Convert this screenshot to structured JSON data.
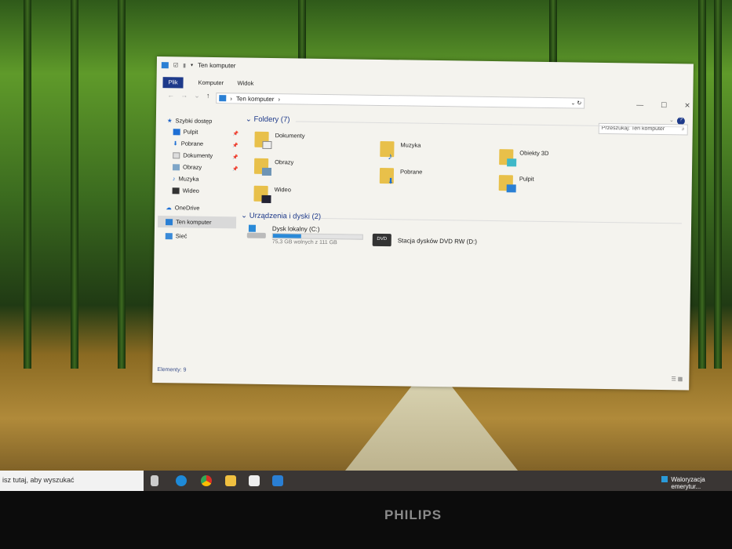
{
  "window": {
    "title": "Ten komputer",
    "tabs": [
      "Plik",
      "Komputer",
      "Widok"
    ],
    "address": "Ten komputer",
    "search_placeholder": "Przeszukaj: Ten komputer",
    "status": "Elementy: 9"
  },
  "nav": [
    "Szybki dostęp",
    "Pulpit",
    "Pobrane",
    "Dokumenty",
    "Obrazy",
    "Muzyka",
    "Wideo",
    "OneDrive",
    "Ten komputer",
    "Sieć"
  ],
  "folders_header": "Foldery (7)",
  "folders": [
    "Dokumenty",
    "Muzyka",
    "Obiekty 3D",
    "Obrazy",
    "Pobrane",
    "Pulpit",
    "Wideo"
  ],
  "devices_header": "Urządzenia i dyski (2)",
  "drive_c": {
    "name": "Dysk lokalny (C:)",
    "free": "75,3 GB wolnych z 111 GB",
    "used_fraction": 0.32
  },
  "drive_d": {
    "name": "Stacja dysków DVD RW (D:)",
    "label": "DVD"
  },
  "taskbar": {
    "search": "isz tutaj, aby wyszukać",
    "notification": "Waloryzacja emerytur..."
  },
  "monitor": {
    "brand": "PHILIPS"
  }
}
